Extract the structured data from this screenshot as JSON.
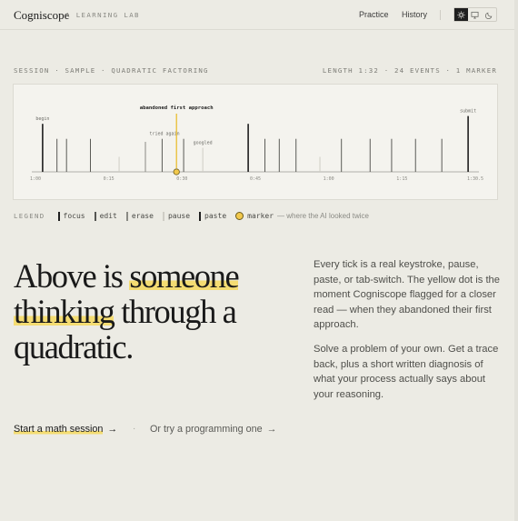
{
  "header": {
    "logo": "Cogniscope",
    "tagline": "A LEARNING LAB",
    "nav": [
      "Practice",
      "History"
    ],
    "theme_icons": [
      "sun-icon",
      "monitor-icon",
      "moon-icon"
    ]
  },
  "session": {
    "left": "SESSION · SAMPLE · QUADRATIC FACTORING",
    "right": "LENGTH 1:32 · 24 EVENTS · 1 MARKER"
  },
  "chart_data": {
    "type": "timeline",
    "x_range_seconds": [
      0,
      92
    ],
    "tick_labels": [
      "1:00",
      "0:15",
      "0:30",
      "0:45",
      "1:00",
      "1:15",
      "1:30.5"
    ],
    "events": [
      {
        "t": 1.5,
        "kind": "focus",
        "h": 0.8
      },
      {
        "t": 4.5,
        "kind": "edit",
        "h": 0.55
      },
      {
        "t": 6.5,
        "kind": "edit",
        "h": 0.55
      },
      {
        "t": 11.5,
        "kind": "edit",
        "h": 0.55
      },
      {
        "t": 17.5,
        "kind": "pause",
        "h": 0.25
      },
      {
        "t": 23.0,
        "kind": "erase",
        "h": 0.5
      },
      {
        "t": 26.5,
        "kind": "edit",
        "h": 0.55
      },
      {
        "t": 31.0,
        "kind": "edit",
        "h": 0.55
      },
      {
        "t": 35.0,
        "kind": "pause",
        "h": 0.4
      },
      {
        "t": 44.5,
        "kind": "focus",
        "h": 0.8
      },
      {
        "t": 48.0,
        "kind": "edit",
        "h": 0.55
      },
      {
        "t": 51.0,
        "kind": "edit",
        "h": 0.55
      },
      {
        "t": 54.5,
        "kind": "edit",
        "h": 0.55
      },
      {
        "t": 59.5,
        "kind": "pause",
        "h": 0.25
      },
      {
        "t": 64.0,
        "kind": "edit",
        "h": 0.55
      },
      {
        "t": 70.0,
        "kind": "edit",
        "h": 0.55
      },
      {
        "t": 74.5,
        "kind": "edit",
        "h": 0.55
      },
      {
        "t": 79.5,
        "kind": "edit",
        "h": 0.55
      },
      {
        "t": 85.0,
        "kind": "edit",
        "h": 0.55
      },
      {
        "t": 90.5,
        "kind": "focus",
        "h": 0.93
      }
    ],
    "labels": [
      {
        "t": 1.5,
        "text": "begin"
      },
      {
        "t": 27.0,
        "text": "tried again"
      },
      {
        "t": 35.0,
        "text": "googled"
      },
      {
        "t": 90.5,
        "text": "submit"
      }
    ],
    "marker": {
      "t": 29.5,
      "label": "abandoned first approach"
    }
  },
  "legend": {
    "title": "LEGEND",
    "items": [
      {
        "label": "focus",
        "color": "#1f1f1f"
      },
      {
        "label": "edit",
        "color": "#555552"
      },
      {
        "label": "erase",
        "color": "#8a8a84"
      },
      {
        "label": "pause",
        "color": "#cfcdc5"
      },
      {
        "label": "paste",
        "color": "#1f1f1f"
      }
    ],
    "marker_label": "marker",
    "marker_note": "— where the AI looked twice"
  },
  "hero": {
    "line1_pre": "Above is ",
    "line1_hl": "someone",
    "line2_hl": "thinking",
    "line2_post": " through a",
    "line3": "quadratic.",
    "para1": "Every tick is a real keystroke, pause, paste, or tab-switch. The yellow dot is the moment Cogniscope flagged for a closer read — when they abandoned their first approach.",
    "para2": "Solve a problem of your own. Get a trace back, plus a short written diagnosis of what your process actually says about your reasoning."
  },
  "cta": {
    "primary": "Start a math session",
    "secondary": "Or try a programming one",
    "arrow": "→",
    "sep": "·"
  },
  "colors": {
    "accent": "#f2c94c",
    "highlight": "#f4dc72",
    "background": "#ecebe4"
  }
}
